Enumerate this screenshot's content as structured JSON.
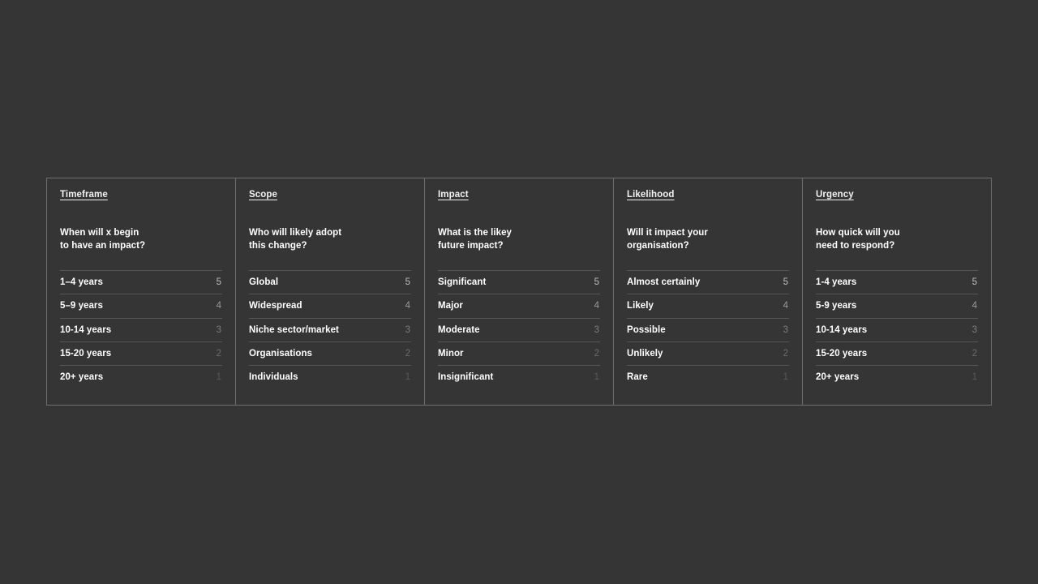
{
  "page": {
    "background_color": "#353535",
    "border_color": "#6e6e6e",
    "divider_color": "#555555",
    "label_color": "#ffffff"
  },
  "table": {
    "columns": [
      {
        "title": "Timeframe",
        "question": "When will x begin\nto have an impact?",
        "rows": [
          {
            "label": "1–4 years",
            "score": "5"
          },
          {
            "label": "5–9 years",
            "score": "4"
          },
          {
            "label": "10-14 years",
            "score": "3"
          },
          {
            "label": "15-20 years",
            "score": "2"
          },
          {
            "label": "20+ years",
            "score": "1"
          }
        ]
      },
      {
        "title": "Scope",
        "question": "Who will likely adopt\nthis change?",
        "rows": [
          {
            "label": "Global",
            "score": "5"
          },
          {
            "label": "Widespread",
            "score": "4"
          },
          {
            "label": "Niche sector/market",
            "score": "3"
          },
          {
            "label": "Organisations",
            "score": "2"
          },
          {
            "label": "Individuals",
            "score": "1"
          }
        ]
      },
      {
        "title": "Impact",
        "question": "What is the likey\nfuture impact?",
        "rows": [
          {
            "label": "Significant",
            "score": "5"
          },
          {
            "label": "Major",
            "score": "4"
          },
          {
            "label": "Moderate",
            "score": "3"
          },
          {
            "label": "Minor",
            "score": "2"
          },
          {
            "label": "Insignificant",
            "score": "1"
          }
        ]
      },
      {
        "title": "Likelihood",
        "question": "Will it impact your\norganisation?",
        "rows": [
          {
            "label": "Almost certainly",
            "score": "5"
          },
          {
            "label": "Likely",
            "score": "4"
          },
          {
            "label": "Possible",
            "score": "3"
          },
          {
            "label": "Unlikely",
            "score": "2"
          },
          {
            "label": "Rare",
            "score": "1"
          }
        ]
      },
      {
        "title": "Urgency",
        "question": "How quick will you\nneed to respond?",
        "rows": [
          {
            "label": "1-4 years",
            "score": "5"
          },
          {
            "label": "5-9 years",
            "score": "4"
          },
          {
            "label": "10-14 years",
            "score": "3"
          },
          {
            "label": "15-20 years",
            "score": "2"
          },
          {
            "label": "20+ years",
            "score": "1"
          }
        ]
      }
    ]
  }
}
